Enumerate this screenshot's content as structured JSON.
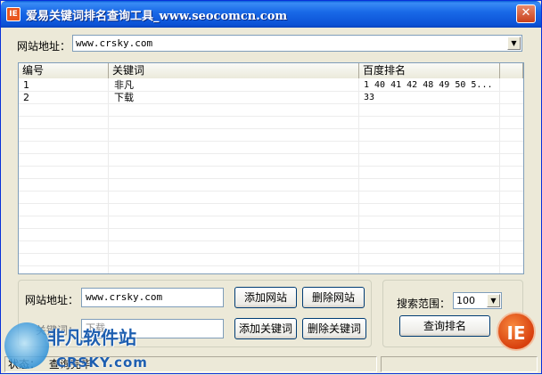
{
  "window": {
    "title": "爱易关键词排名查询工具_www.seocomcn.com",
    "icon_text": "IE",
    "close_glyph": "✕"
  },
  "top": {
    "site_label": "网站地址：",
    "site_value": "www.crsky.com"
  },
  "table": {
    "columns": [
      "编号",
      "关键词",
      "百度排名"
    ],
    "rows": [
      {
        "id": "1",
        "keyword": "非凡",
        "rank": "1 40 41 42 48 49 50 5..."
      },
      {
        "id": "2",
        "keyword": "下载",
        "rank": "33"
      }
    ]
  },
  "form": {
    "site_label": "网站地址：",
    "site_value": "www.crsky.com",
    "add_site": "添加网站",
    "delete_site": "删除网站",
    "keyword_label": "关键词：",
    "keyword_value": "下载",
    "add_keyword": "添加关键词",
    "delete_keyword": "删除关键词"
  },
  "search": {
    "range_label": "搜索范围：",
    "range_value": "100",
    "query_button": "查询排名"
  },
  "status": {
    "label": "状态：",
    "text": "查询完毕"
  },
  "badge": {
    "text": "IE"
  },
  "watermark": {
    "text": "非凡软件站",
    "sub": "CRSKY.com"
  },
  "colors": {
    "titlebar": "#0b52d6",
    "window_bg": "#ece9d8",
    "badge": "#d8400e",
    "watermark": "#1e5fb0"
  }
}
